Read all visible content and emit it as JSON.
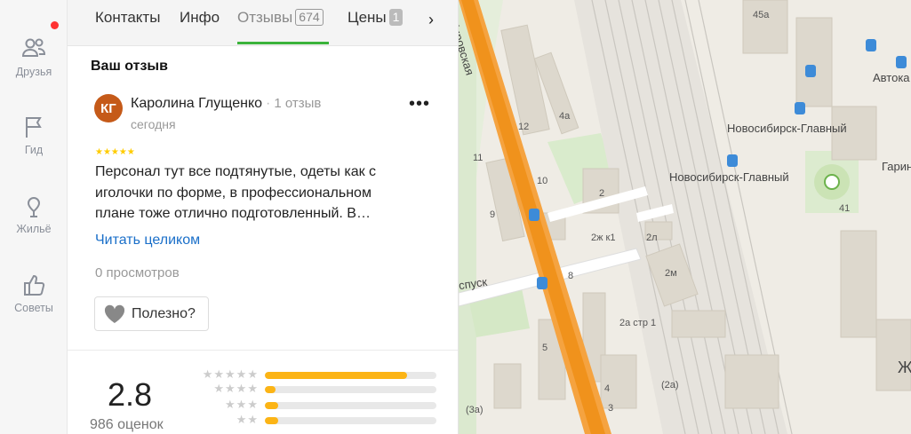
{
  "rail": {
    "items": [
      {
        "label": "Друзья",
        "icon": "friends-icon"
      },
      {
        "label": "Гид",
        "icon": "flag-icon"
      },
      {
        "label": "Жильё",
        "icon": "housing-icon"
      },
      {
        "label": "Советы",
        "icon": "thumbs-up-icon"
      }
    ]
  },
  "tabs": {
    "items": [
      {
        "label": "Контакты"
      },
      {
        "label": "Инфо"
      },
      {
        "label": "Отзывы",
        "count": "674"
      },
      {
        "label": "Цены",
        "count": "1"
      }
    ],
    "active": "Отзывы",
    "next_icon": "›"
  },
  "review": {
    "section_title": "Ваш отзыв",
    "avatar_initials": "КГ",
    "avatar_color": "#c55a19",
    "author": "Каролина Глущенко",
    "author_reviews": "1 отзыв",
    "date": "сегодня",
    "stars": "★★★★★",
    "text": "Персонал тут все подтянутые, одеты как с иголочки по форме, в профессиональном плане тоже отлично подготовленный. В…",
    "read_more": "Читать целиком",
    "views": "0 просмотров",
    "useful_label": "Полезно?",
    "more_icon": "•••"
  },
  "rating": {
    "value": "2.8",
    "count_label": "986 оценок",
    "accent": "#fcb415",
    "distribution": [
      {
        "stars": "★★★★★",
        "fraction": 0.83
      },
      {
        "stars": "★★★★",
        "fraction": 0.06
      },
      {
        "stars": "★★★",
        "fraction": 0.08
      },
      {
        "stars": "★★",
        "fraction": 0.08
      }
    ]
  },
  "map": {
    "street": "Кировская",
    "street2": "спуск",
    "station1": "Новосибирск-Главный",
    "station2": "Новосибирск-Главный",
    "label_avto": "Автока",
    "label_garin": "Гарина",
    "label_zh": "Ж",
    "houses": [
      "45а",
      "12",
      "4а",
      "11",
      "10",
      "2",
      "9",
      "2ж к1",
      "2л",
      "8",
      "2м",
      "2а стр 1",
      "5",
      "4",
      "(2а)",
      "3",
      "(3а)",
      "41"
    ]
  }
}
